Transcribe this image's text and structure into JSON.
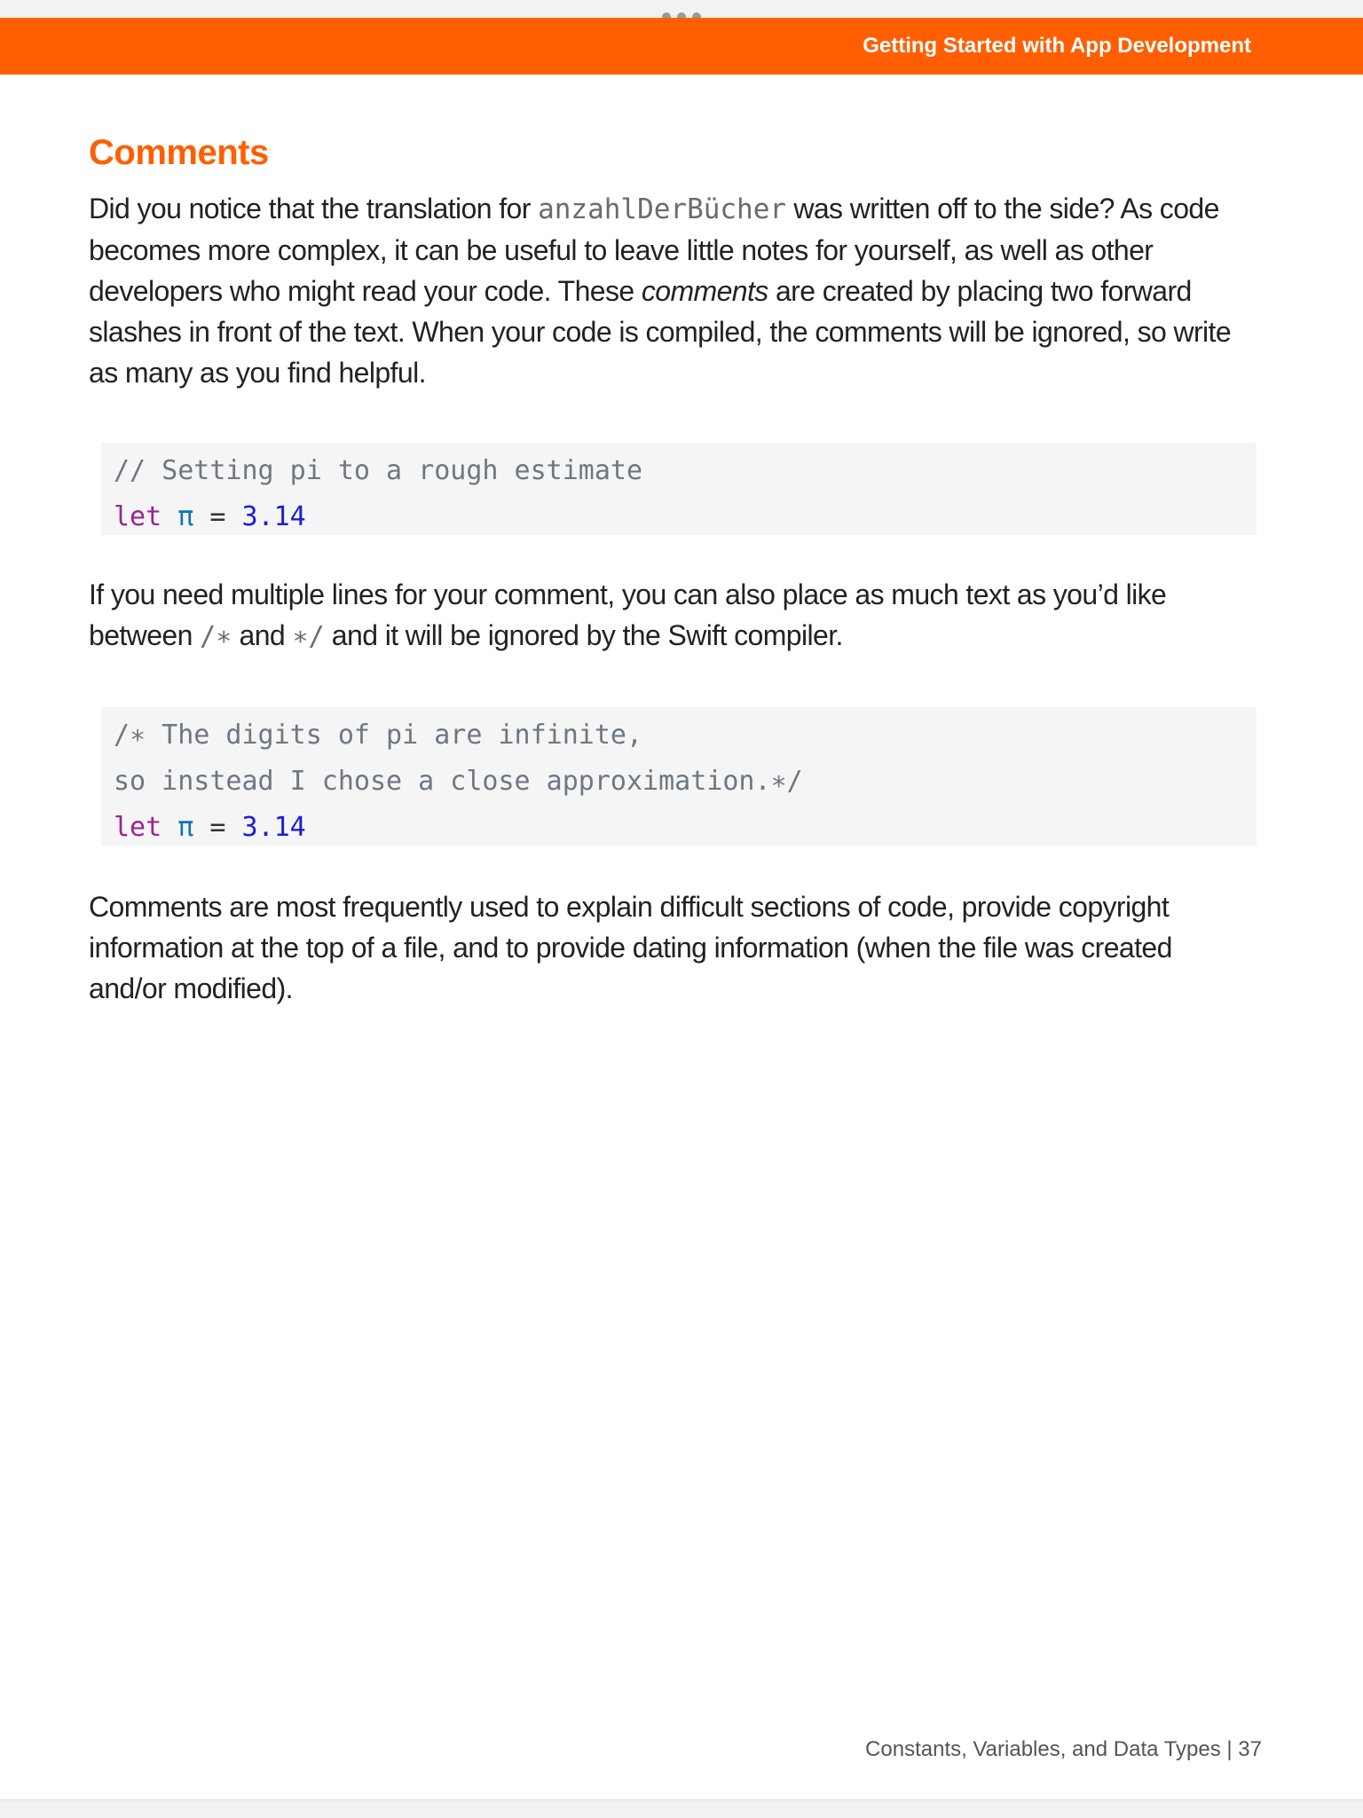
{
  "header": {
    "title": "Getting Started with App Development"
  },
  "section": {
    "heading": "Comments"
  },
  "paragraphs": {
    "p1_a": "Did you notice that the translation for ",
    "p1_code": "anzahlDerBücher",
    "p1_b": " was written off to the side? As code becomes more complex, it can be useful to leave little notes for yourself, as well as other developers who might read your code. These ",
    "p1_em": "comments",
    "p1_c": " are created by placing two forward slashes in front of the text. When your code is compiled, the comments will be ignored, so write as many as you find helpful.",
    "p2_a": "If you need multiple lines for your comment, you can also place as much text as you’d like between ",
    "p2_open": "/∗",
    "p2_b": " and ",
    "p2_close": "∗/",
    "p2_c": " and it will be ignored by the Swift compiler.",
    "p3": "Comments are most frequently used to explain difficult sections of code, provide copyright information at the top of a file, and to provide dating information (when the file was created and/or modified)."
  },
  "code_block_1": {
    "comment": "// Setting pi to a rough estimate",
    "keyword": "let",
    "identifier": "π",
    "operator": "=",
    "number": "3.14"
  },
  "code_block_2": {
    "comment_line_1": "/∗ The digits of pi are infinite,",
    "comment_line_2": "so instead I chose a close approximation.∗/",
    "keyword": "let",
    "identifier": "π",
    "operator": "=",
    "number": "3.14"
  },
  "footer": {
    "text": "Constants, Variables, and Data Types  |  37"
  },
  "colors": {
    "accent": "#ff5f00",
    "code_background": "#f5f5f5",
    "keyword": "#9b2393",
    "number": "#1c1cd6",
    "comment": "#6e7781"
  }
}
